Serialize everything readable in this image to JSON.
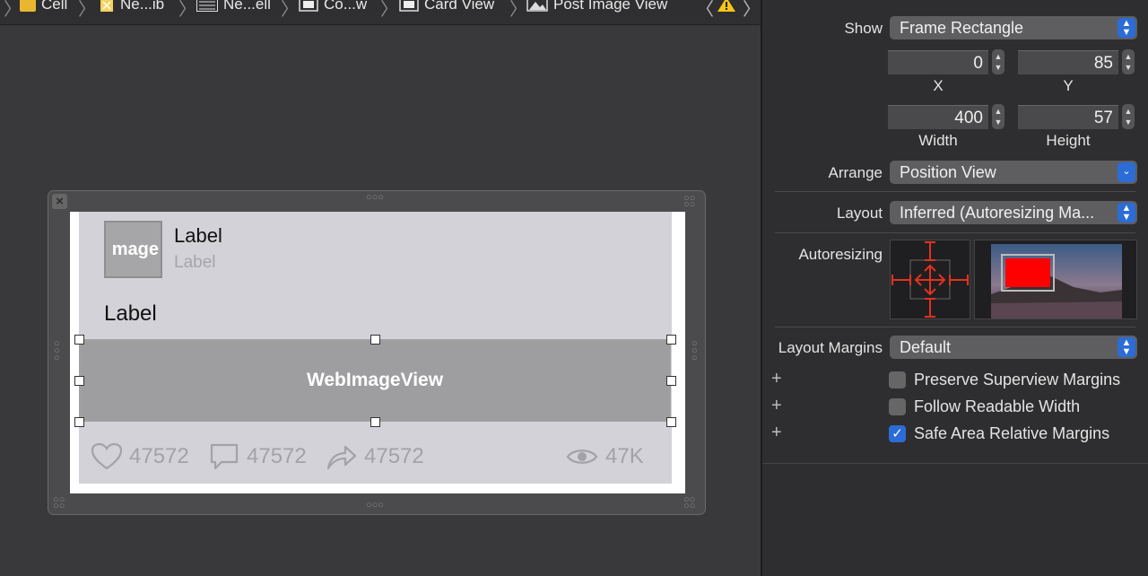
{
  "breadcrumb": {
    "items": [
      {
        "label": "Cell",
        "icon": "folder-icon"
      },
      {
        "label": "Ne...ib",
        "icon": "xib-file-icon"
      },
      {
        "label": "Ne...ell",
        "icon": "table-cell-icon"
      },
      {
        "label": "Co...w",
        "icon": "view-icon"
      },
      {
        "label": "Card View",
        "icon": "view-icon"
      },
      {
        "label": "Post Image View",
        "icon": "image-view-icon"
      }
    ]
  },
  "canvas": {
    "avatar_text": "mage",
    "title_label": "Label",
    "subtitle_label": "Label",
    "body_label": "Label",
    "webimage_label": "WebImageView",
    "stats": {
      "likes": "47572",
      "comments": "47572",
      "shares": "47572",
      "views": "47K"
    }
  },
  "inspector": {
    "show_label": "Show",
    "show_value": "Frame Rectangle",
    "x_value": "0",
    "y_value": "85",
    "x_label": "X",
    "y_label": "Y",
    "width_value": "400",
    "height_value": "57",
    "width_label": "Width",
    "height_label": "Height",
    "arrange_label": "Arrange",
    "arrange_value": "Position View",
    "layout_label": "Layout",
    "layout_value": "Inferred (Autoresizing Ma...",
    "autoresizing_label": "Autoresizing",
    "layout_margins_label": "Layout Margins",
    "layout_margins_value": "Default",
    "checkboxes": [
      {
        "label": "Preserve Superview Margins",
        "checked": false
      },
      {
        "label": "Follow Readable Width",
        "checked": false
      },
      {
        "label": "Safe Area Relative Margins",
        "checked": true
      }
    ]
  },
  "colors": {
    "accent": "#2b6cd6",
    "autoresize_strut": "#e0321e",
    "preview_red": "#ff0000"
  }
}
